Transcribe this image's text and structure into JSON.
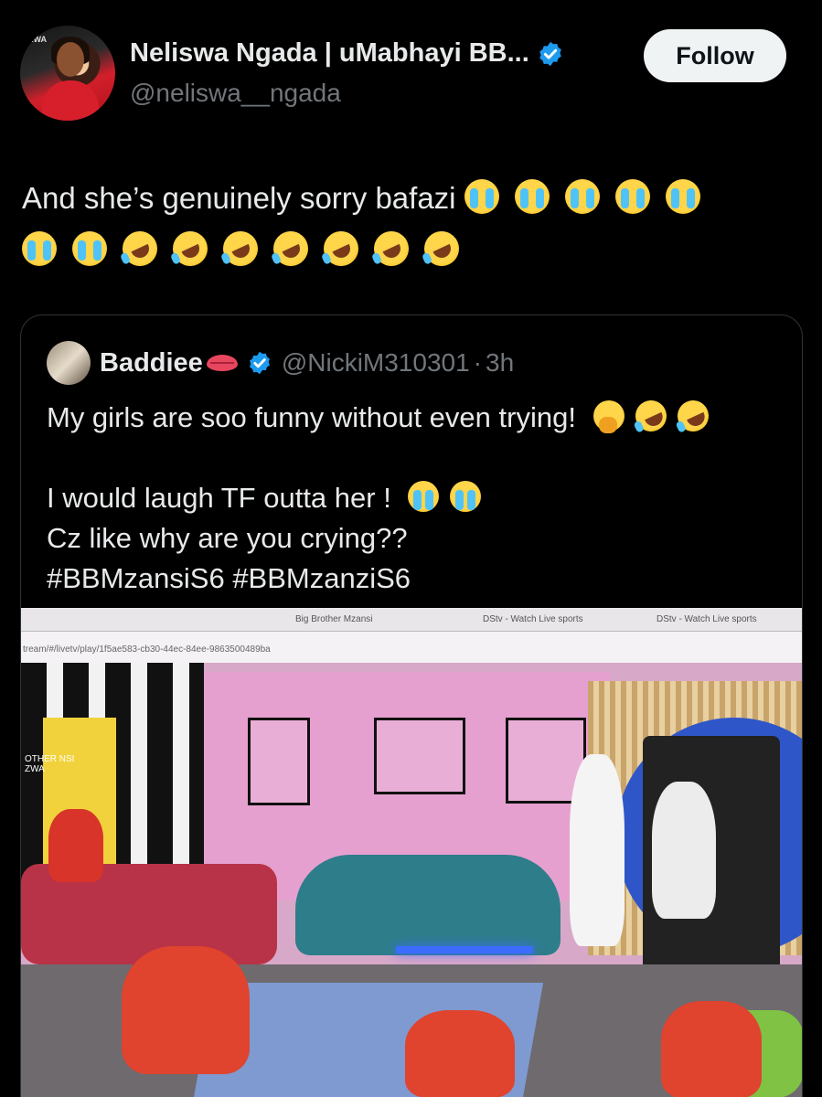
{
  "author": {
    "display_name": "Neliswa Ngada | uMabhayi BB...",
    "handle": "@neliswa__ngada",
    "verified": true,
    "avatar_logo_text": "OZWA"
  },
  "follow_label": "Follow",
  "tweet": {
    "text": "And she’s genuinely sorry bafazi",
    "emojis_line1": [
      "loudly-crying",
      "loudly-crying",
      "loudly-crying",
      "loudly-crying",
      "loudly-crying"
    ],
    "emojis_line2": [
      "loudly-crying",
      "loudly-crying",
      "rofl",
      "rofl",
      "rofl",
      "rofl",
      "rofl",
      "rofl",
      "rofl"
    ]
  },
  "quote": {
    "name": "Baddiee",
    "name_emoji": "lips-icon",
    "verified": true,
    "handle": "@NickiM310301",
    "dot": "·",
    "time": "3h",
    "line1": "My girls are soo funny without even trying!",
    "line1_emojis": [
      "face-with-hand-over-mouth",
      "rofl",
      "rofl"
    ],
    "line2": "I would laugh TF outta her !",
    "line2_emojis": [
      "loudly-crying",
      "loudly-crying"
    ],
    "line3": "Cz like why are you crying??",
    "line4": "#BBMzansiS6 #BBMzanziS6"
  },
  "photo": {
    "tab1": "Big Brother Mzansi",
    "tab2": "DStv - Watch Live sports",
    "tab3": "DStv - Watch Live sports",
    "url": "tream/#/livetv/play/1f5ae583-cb30-44ec-84ee-9863500489ba",
    "wall_sign": "OTHER NSI ZWA"
  },
  "colors": {
    "background": "#000000",
    "text_primary": "#e7e9ea",
    "text_secondary": "#71767b",
    "verified_blue": "#1d9bf0",
    "border": "#2f3336",
    "follow_bg": "#eff3f4"
  }
}
